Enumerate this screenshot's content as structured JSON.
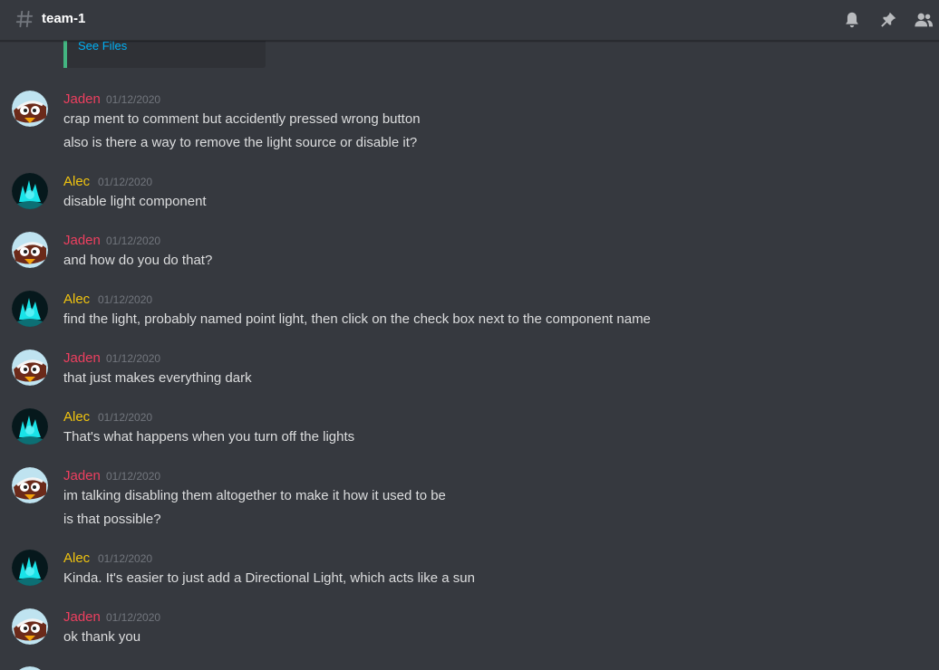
{
  "header": {
    "channel_name": "team-1",
    "icons": [
      "hash-icon",
      "bell-icon",
      "pin-icon",
      "members-icon"
    ]
  },
  "embed": {
    "link_text": "See Files",
    "accent_color": "#43b581"
  },
  "colors": {
    "background": "#36393f",
    "jaden": "#ed3f5f",
    "alec": "#f1c40f",
    "text": "#dcddde",
    "timestamp": "#72767d",
    "link": "#00b0f4"
  },
  "messages": [
    {
      "author": "Jaden",
      "timestamp": "01/12/2020",
      "lines": [
        "crap ment to comment but accidently pressed wrong button",
        "also is there a way to remove the light source or disable it?"
      ]
    },
    {
      "author": "Alec",
      "timestamp": "01/12/2020",
      "lines": [
        "disable light component"
      ]
    },
    {
      "author": "Jaden",
      "timestamp": "01/12/2020",
      "lines": [
        "and how do you do that?"
      ]
    },
    {
      "author": "Alec",
      "timestamp": "01/12/2020",
      "lines": [
        "find the light, probably named point light, then click on the check box next to the component name"
      ]
    },
    {
      "author": "Jaden",
      "timestamp": "01/12/2020",
      "lines": [
        "that just makes everything dark"
      ]
    },
    {
      "author": "Alec",
      "timestamp": "01/12/2020",
      "lines": [
        "That's what happens when you turn off the lights"
      ]
    },
    {
      "author": "Jaden",
      "timestamp": "01/12/2020",
      "lines": [
        "im talking disabling them altogether to make it how it used to be",
        "is that possible?"
      ]
    },
    {
      "author": "Alec",
      "timestamp": "01/12/2020",
      "lines": [
        "Kinda. It's easier to just add a Directional Light, which acts like a sun"
      ]
    },
    {
      "author": "Jaden",
      "timestamp": "01/12/2020",
      "lines": [
        "ok thank you"
      ]
    }
  ]
}
